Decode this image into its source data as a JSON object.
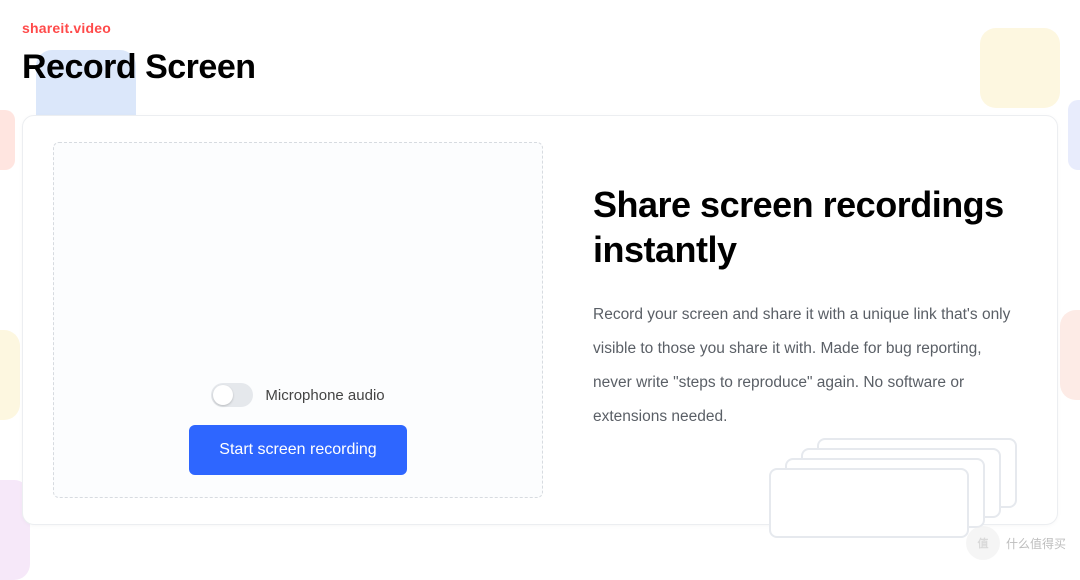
{
  "header": {
    "brand": "shareit.video",
    "title": "Record Screen"
  },
  "recorder": {
    "mic_toggle_label": "Microphone audio",
    "mic_enabled": false,
    "start_button_label": "Start screen recording"
  },
  "hero": {
    "heading": "Share screen recordings instantly",
    "description": "Record your screen and share it with a unique link that's only visible to those you share it with. Made for bug reporting, never write \"steps to reproduce\" again. No software or extensions needed."
  },
  "watermark": {
    "badge": "值",
    "text": "什么值得买"
  }
}
